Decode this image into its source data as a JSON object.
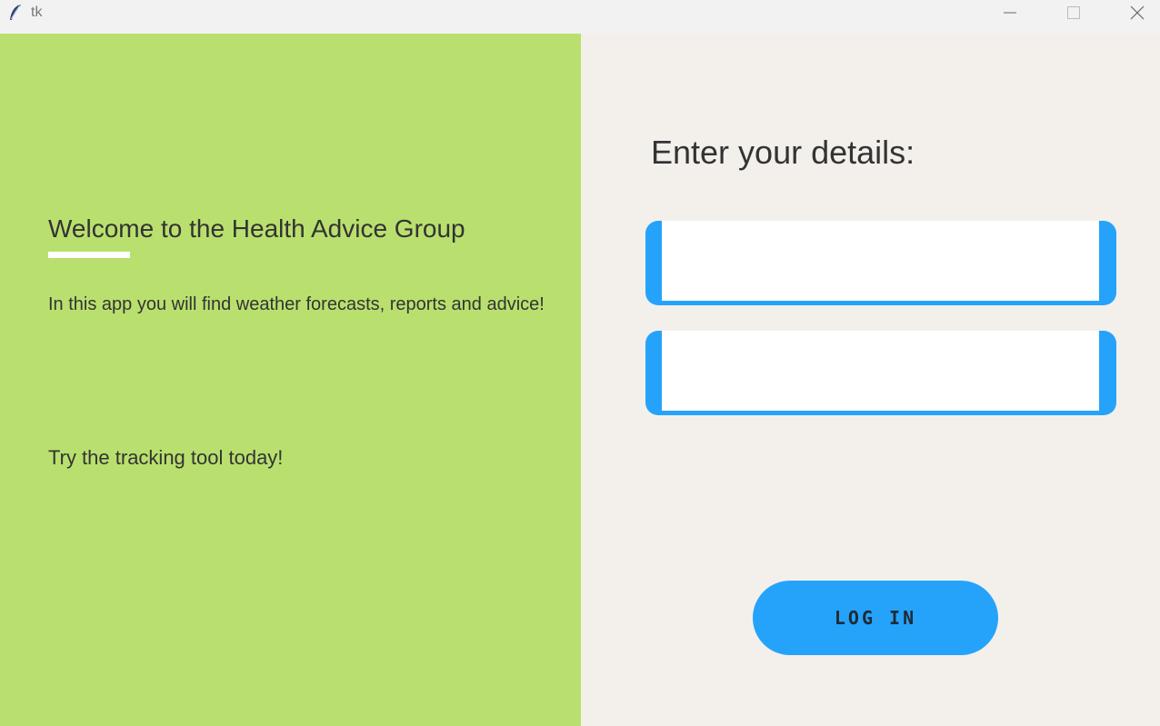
{
  "window": {
    "title": "tk",
    "app_icon": "feather-icon",
    "controls": [
      "minimize-icon",
      "maximize-icon",
      "close-icon"
    ]
  },
  "left_panel": {
    "heading": "Welcome to the Health Advice Group",
    "intro": "In this app you will find weather forecasts, reports and advice!",
    "cta": "Try the tracking tool today!",
    "background": "#b9e06e"
  },
  "login_form": {
    "heading": "Enter your details:",
    "username_value": "",
    "password_value": "",
    "login_button": "LOG IN",
    "accent": "#25a3fb",
    "background": "#f3f0ec"
  }
}
